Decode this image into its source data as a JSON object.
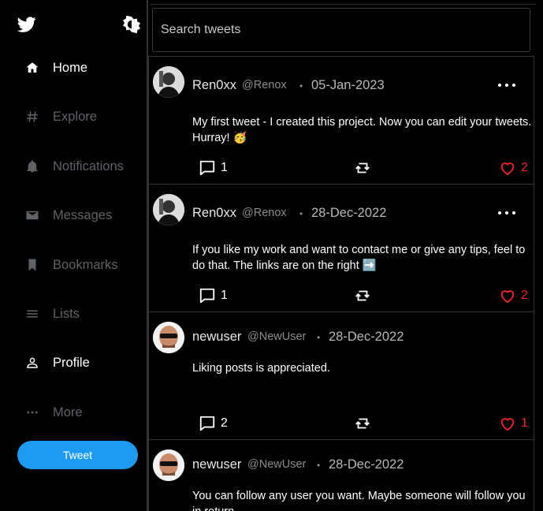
{
  "sidebar": {
    "items": [
      {
        "label": "Home",
        "icon": "home-icon"
      },
      {
        "label": "Explore",
        "icon": "hashtag-icon"
      },
      {
        "label": "Notifications",
        "icon": "bell-icon"
      },
      {
        "label": "Messages",
        "icon": "mail-icon"
      },
      {
        "label": "Bookmarks",
        "icon": "bookmark-icon"
      },
      {
        "label": "Lists",
        "icon": "list-icon"
      },
      {
        "label": "Profile",
        "icon": "user-icon"
      },
      {
        "label": "More",
        "icon": "more-dots-icon"
      }
    ],
    "tweet_button": "Tweet"
  },
  "search": {
    "placeholder": "Search tweets"
  },
  "posts": [
    {
      "name": "Ren0xx",
      "handle": "@Renox",
      "date": "05-Jan-2023",
      "text": "My first tweet - I created this project. Now you can edit your tweets. Hurray! 🥳",
      "replies": "1",
      "likes": "2"
    },
    {
      "name": "Ren0xx",
      "handle": "@Renox",
      "date": "28-Dec-2022",
      "text": "If you like my work and want to contact me or give any tips, feel to do that. The links are on the right ➡️",
      "replies": "1",
      "likes": "2"
    },
    {
      "name": "newuser",
      "handle": "@NewUser",
      "date": "28-Dec-2022",
      "text": "Liking posts is appreciated.",
      "replies": "2",
      "likes": "1"
    },
    {
      "name": "newuser",
      "handle": "@NewUser",
      "date": "28-Dec-2022",
      "text": "You can follow any user you want. Maybe someone will follow you in return.",
      "replies": "",
      "likes": ""
    }
  ],
  "colors": {
    "accent": "#1d9bf0",
    "like": "#f4212e",
    "background": "#000000"
  }
}
